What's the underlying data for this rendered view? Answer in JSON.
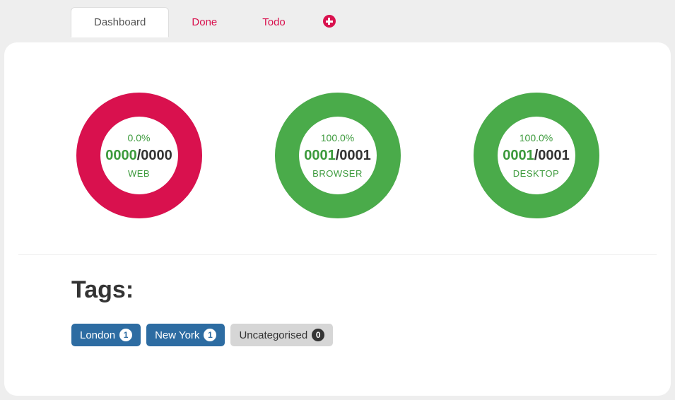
{
  "tabs": {
    "dashboard": "Dashboard",
    "done": "Done",
    "todo": "Todo"
  },
  "charts": [
    {
      "percent_text": "0.0%",
      "progress": 0,
      "done": "0000",
      "total": "0000",
      "label": "WEB"
    },
    {
      "percent_text": "100.0%",
      "progress": 100,
      "done": "0001",
      "total": "0001",
      "label": "BROWSER"
    },
    {
      "percent_text": "100.0%",
      "progress": 100,
      "done": "0001",
      "total": "0001",
      "label": "DESKTOP"
    }
  ],
  "colors": {
    "green": "#4aab4a",
    "red": "#d9114e",
    "track": "#cccccc"
  },
  "tags_section": {
    "title": "Tags:",
    "tags": [
      {
        "label": "London",
        "count": "1",
        "style": "primary"
      },
      {
        "label": "New York",
        "count": "1",
        "style": "primary"
      },
      {
        "label": "Uncategorised",
        "count": "0",
        "style": "secondary"
      }
    ]
  }
}
